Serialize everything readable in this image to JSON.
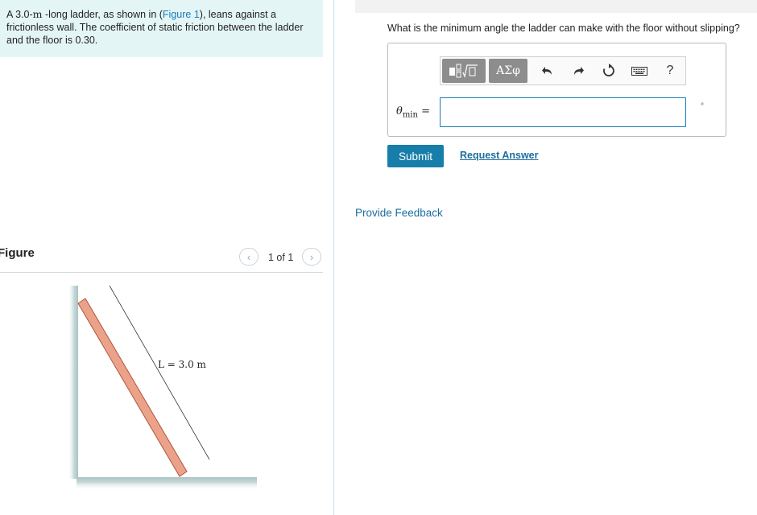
{
  "problem": {
    "lead": "A 3.0-",
    "unit": "m",
    "text_part1": " -long ladder, as shown in (",
    "figure_link": "Figure 1",
    "text_part2": "), leans against a frictionless wall. The coefficient of static friction between the ladder and the floor is 0.30."
  },
  "figure": {
    "title": "Figure",
    "pager_text": "1 of 1",
    "length_label": "L = 3.0 m",
    "ladder_color": "#eaa38a",
    "wall_color": "#b9cfcf"
  },
  "question": {
    "text": "What is the minimum angle the ladder can make with the floor without slipping?"
  },
  "toolbar": {
    "templates_icon": "fraction-sqrt-icon",
    "symbols_label": "ΑΣφ",
    "undo_icon": "undo-icon",
    "redo_icon": "redo-icon",
    "reset_icon": "reset-icon",
    "keyboard_icon": "keyboard-icon",
    "help_label": "?"
  },
  "answer": {
    "variable": "θ",
    "subscript": "min",
    "equals": " =",
    "value": "",
    "unit": "°"
  },
  "buttons": {
    "submit": "Submit",
    "request_answer": "Request Answer"
  },
  "feedback": {
    "link": "Provide Feedback"
  },
  "colors": {
    "accent": "#177eaa",
    "link": "#1a7cb8",
    "problem_bg": "#e4f5f5"
  }
}
